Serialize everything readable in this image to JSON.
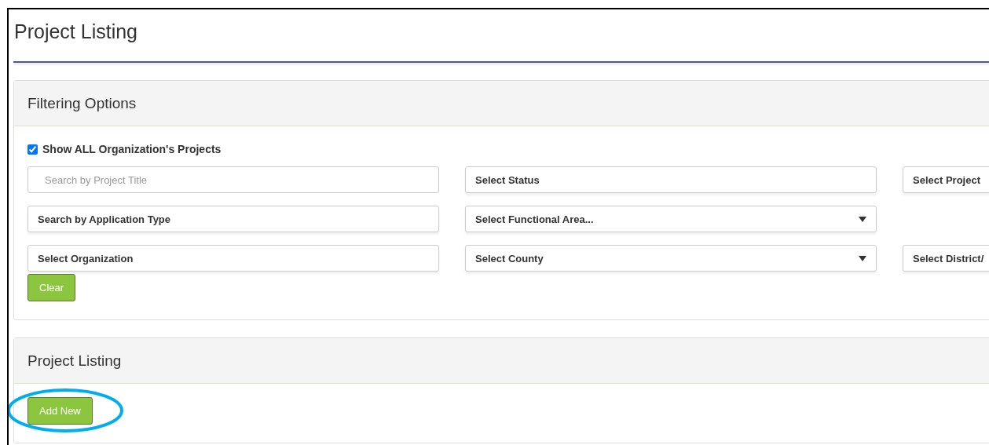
{
  "page": {
    "title": "Project Listing"
  },
  "filter_panel": {
    "title": "Filtering Options",
    "show_all": {
      "label": "Show ALL Organization's Projects",
      "checked": true
    },
    "rows": [
      [
        {
          "kind": "input",
          "placeholder": "Search by Project Title"
        },
        {
          "kind": "select",
          "label": "Select Status",
          "arrow": false
        },
        {
          "kind": "select",
          "label": "Select Project"
        }
      ],
      [
        {
          "kind": "select",
          "label": "Search by Application Type",
          "arrow": false
        },
        {
          "kind": "select",
          "label": "Select Functional Area...",
          "arrow": true
        },
        {
          "kind": "blank"
        }
      ],
      [
        {
          "kind": "select",
          "label": "Select Organization",
          "arrow": false
        },
        {
          "kind": "select",
          "label": "Select County",
          "arrow": true
        },
        {
          "kind": "select",
          "label": "Select District/"
        }
      ]
    ],
    "clear_button": "Clear"
  },
  "listing_panel": {
    "title": "Project Listing",
    "add_button": {
      "label": "Add New",
      "circled": true
    }
  }
}
